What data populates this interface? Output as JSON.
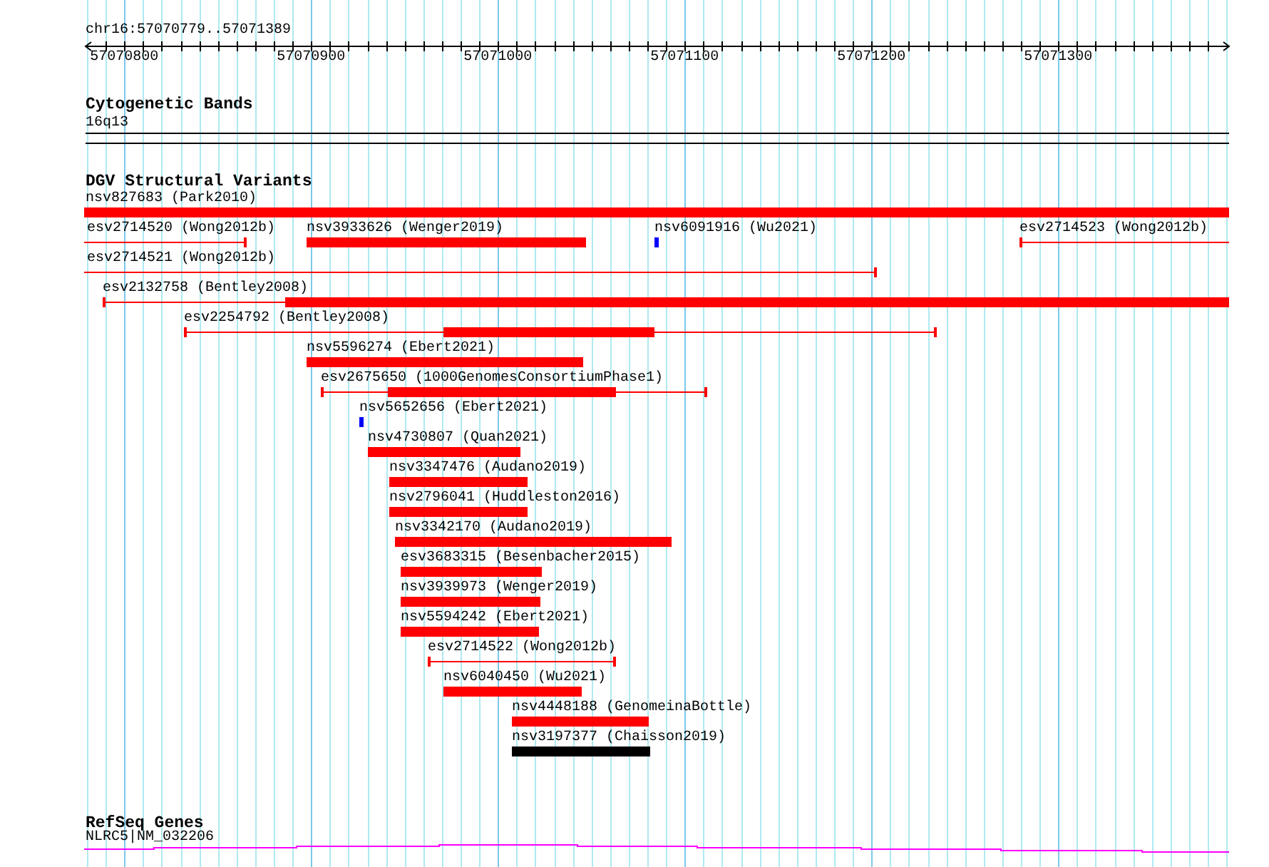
{
  "ruler": {
    "location": "chr16:57070779..57071389",
    "ticks": [
      "57070800",
      "57070900",
      "57071000",
      "57071100",
      "57071200",
      "57071300"
    ]
  },
  "tracks": [
    {
      "title": "Cytogenetic Bands",
      "kind": "bands",
      "features": [
        {
          "label": "16q13"
        }
      ]
    },
    {
      "title": "DGV Structural Variants",
      "kind": "variants",
      "features": [
        {
          "label": "nsv827683 (Park2010)",
          "kind": "block",
          "color": "#ff0000"
        },
        {
          "label": "esv2714520 (Wong2012b)",
          "kind": "span",
          "color": "#ff0000"
        },
        {
          "label": "nsv3933626 (Wenger2019)",
          "kind": "block",
          "color": "#ff0000"
        },
        {
          "label": "nsv6091916 (Wu2021)",
          "kind": "block",
          "color": "#0000ff"
        },
        {
          "label": "esv2714523 (Wong2012b)",
          "kind": "span",
          "color": "#ff0000"
        },
        {
          "label": "esv2714521 (Wong2012b)",
          "kind": "span",
          "color": "#ff0000"
        },
        {
          "label": "esv2132758 (Bentley2008)",
          "kind": "span",
          "color": "#ff0000"
        },
        {
          "label": "esv2254792 (Bentley2008)",
          "kind": "span",
          "color": "#ff0000"
        },
        {
          "label": "nsv5596274 (Ebert2021)",
          "kind": "block",
          "color": "#ff0000"
        },
        {
          "label": "esv2675650 (1000GenomesConsortiumPhase1)",
          "kind": "span",
          "color": "#ff0000"
        },
        {
          "label": "nsv5652656 (Ebert2021)",
          "kind": "block",
          "color": "#0000ff"
        },
        {
          "label": "nsv4730807 (Quan2021)",
          "kind": "block",
          "color": "#ff0000"
        },
        {
          "label": "nsv3347476 (Audano2019)",
          "kind": "block",
          "color": "#ff0000"
        },
        {
          "label": "nsv2796041 (Huddleston2016)",
          "kind": "block",
          "color": "#ff0000"
        },
        {
          "label": "nsv3342170 (Audano2019)",
          "kind": "block",
          "color": "#ff0000"
        },
        {
          "label": "esv3683315 (Besenbacher2015)",
          "kind": "block",
          "color": "#ff0000"
        },
        {
          "label": "nsv3939973 (Wenger2019)",
          "kind": "block",
          "color": "#ff0000"
        },
        {
          "label": "nsv5594242 (Ebert2021)",
          "kind": "block",
          "color": "#ff0000"
        },
        {
          "label": "esv2714522 (Wong2012b)",
          "kind": "span",
          "color": "#ff0000"
        },
        {
          "label": "nsv6040450 (Wu2021)",
          "kind": "block",
          "color": "#ff0000"
        },
        {
          "label": "nsv4448188 (GenomeinaBottle)",
          "kind": "block",
          "color": "#ff0000"
        },
        {
          "label": "nsv3197377 (Chaisson2019)",
          "kind": "block",
          "color": "#000000"
        }
      ]
    },
    {
      "title": "RefSeq Genes",
      "kind": "genes",
      "features": [
        {
          "label": "NLRC5|NM_032206",
          "color": "#ff00ff"
        }
      ]
    }
  ]
}
